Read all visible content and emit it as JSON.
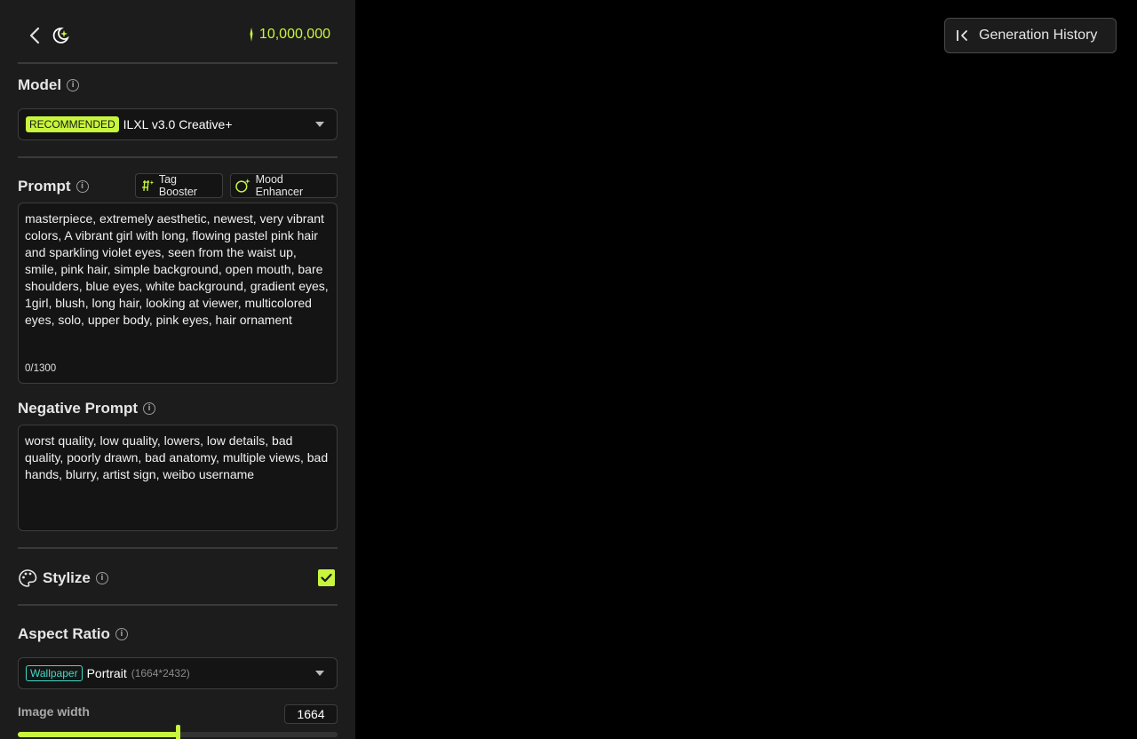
{
  "header": {
    "credits": "10,000,000"
  },
  "model": {
    "label": "Model",
    "badge": "RECOMMENDED",
    "selected": "ILXL v3.0 Creative+"
  },
  "prompt": {
    "label": "Prompt",
    "tag_booster": "Tag Booster",
    "mood_enhancer": "Mood Enhancer",
    "value": "masterpiece, extremely aesthetic, newest, very vibrant colors, A vibrant girl with long, flowing pastel pink hair and sparkling violet eyes, seen from the waist up, smile, pink hair, simple background, open mouth, bare shoulders, blue eyes, white background, gradient eyes,  1girl, blush, long hair, looking at viewer, multicolored eyes, solo, upper body, pink eyes, hair ornament",
    "counter": "0/1300"
  },
  "negative_prompt": {
    "label": "Negative Prompt",
    "value": "worst quality, low quality, lowers, low details, bad quality, poorly drawn, bad anatomy, multiple views, bad hands, blurry, artist sign, weibo username"
  },
  "stylize": {
    "label": "Stylize",
    "checked": true
  },
  "aspect_ratio": {
    "label": "Aspect Ratio",
    "badge": "Wallpaper",
    "selected": "Portrait",
    "dimensions": "(1664*2432)"
  },
  "image_width": {
    "label": "Image width",
    "value": "1664",
    "slider_fraction": 0.5
  },
  "history": {
    "label": "Generation History"
  },
  "colors": {
    "accent": "#c8f53d",
    "panel": "#1c1c1c",
    "field": "#141414",
    "teal": "#41d9c6"
  }
}
